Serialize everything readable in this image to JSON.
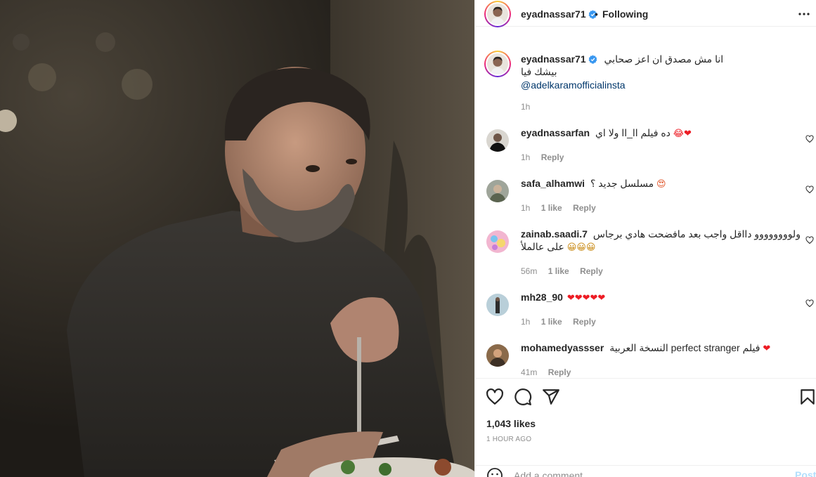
{
  "post": {
    "author": "eyadnassar71",
    "follow_status": "Following",
    "follow_separator": "•",
    "caption_line1": "انا مش مصدق ان اعز صحابي",
    "caption_line2": "بيشك فيا",
    "caption_mention": "@adelkaramofficialinsta",
    "caption_time": "1h",
    "likes": "1,043 likes",
    "time_ago": "1 HOUR AGO"
  },
  "comments": [
    {
      "user": "eyadnassarfan",
      "text": "ده فيلم اا_اا ولا اي",
      "emoji": "😂❤",
      "time": "1h",
      "likes": "",
      "reply": "Reply"
    },
    {
      "user": "safa_alhamwi",
      "text": "مسلسل جديد ؟",
      "emoji": "😍",
      "time": "1h",
      "likes": "1 like",
      "reply": "Reply"
    },
    {
      "user": "zainab.saadi.7",
      "text": "ولوووووووو دااقل واجب بعد مافضحت هادي برجاس",
      "text2": "على عالملأ",
      "emoji": "😀😀😀",
      "time": "56m",
      "likes": "1 like",
      "reply": "Reply"
    },
    {
      "user": "mh28_90",
      "text": "",
      "emoji": "❤❤❤❤❤",
      "time": "1h",
      "likes": "1 like",
      "reply": "Reply"
    },
    {
      "user": "mohamedyassser",
      "text": "فيلم perfect stranger النسخة العربية",
      "emoji": "❤",
      "time": "41m",
      "likes": "",
      "reply": "Reply"
    }
  ],
  "composer": {
    "placeholder": "Add a comment...",
    "post_label": "Post"
  },
  "colors": {
    "link": "#00376b",
    "verified": "#3897f0",
    "heart": "#ed1c24",
    "post_disabled": "#b2dffc",
    "muted": "#8e8e8e"
  },
  "icons": [
    "verified-icon",
    "more-icon",
    "heart-icon",
    "comment-icon",
    "share-icon",
    "bookmark-icon",
    "emoji-icon"
  ]
}
